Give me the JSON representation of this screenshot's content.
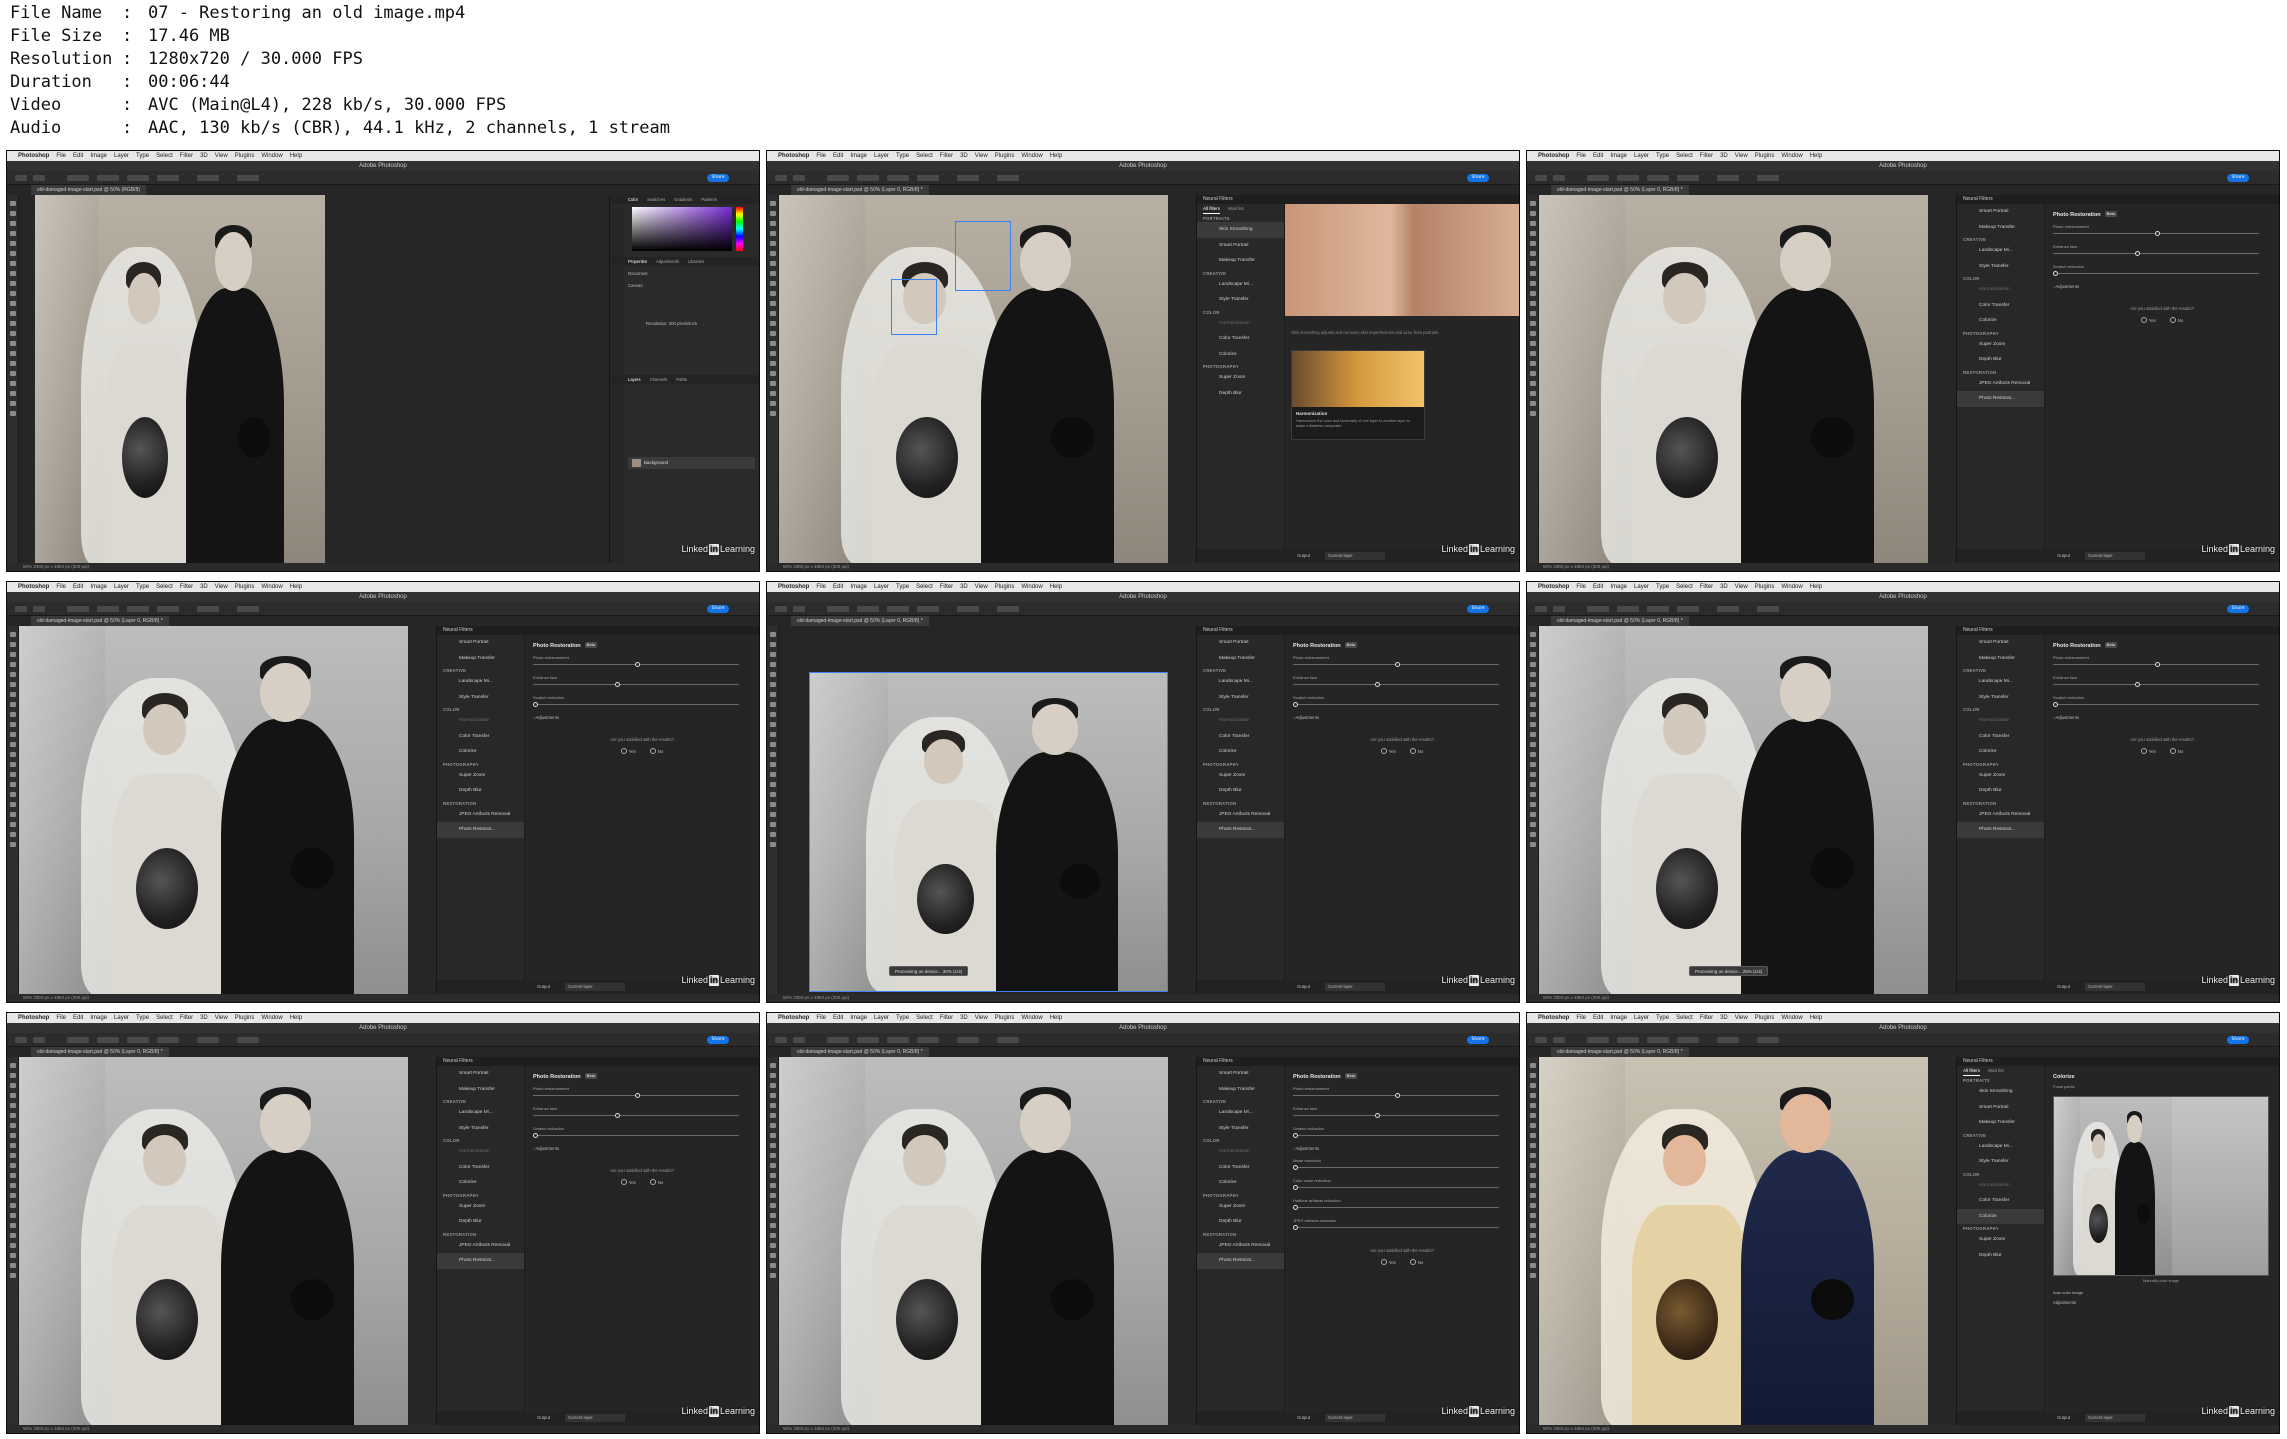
{
  "file_info": [
    {
      "key": "File Name",
      "value": "07 - Restoring an old image.mp4"
    },
    {
      "key": "File Size",
      "value": "17.46 MB"
    },
    {
      "key": "Resolution",
      "value": "1280x720 / 30.000 FPS"
    },
    {
      "key": "Duration",
      "value": "00:06:44"
    },
    {
      "key": "Video",
      "value": "AVC (Main@L4), 228 kb/s, 30.000 FPS"
    },
    {
      "key": "Audio",
      "value": "AAC, 130 kb/s (CBR), 44.1 kHz, 2 channels, 1 stream"
    }
  ],
  "ps": {
    "apple": "",
    "menu_app": "Photoshop",
    "menu_items": [
      "File",
      "Edit",
      "Image",
      "Layer",
      "Type",
      "Select",
      "Filter",
      "3D",
      "View",
      "Plugins",
      "Window",
      "Help"
    ],
    "window_title": "Adobe Photoshop",
    "doc_tab_first": "old-damaged-image-start.psd @ 50% (RGB/8)",
    "doc_tab": "old-damaged-image-start.psd @ 50% (Layer 0, RGB/8) *",
    "status": "50%      3393 px x 4884 px (300 ppi)",
    "share": "Share",
    "brand": {
      "linked": "Linked",
      "in": "in",
      "learning": "Learning"
    }
  },
  "props": {
    "tabs": [
      "Color",
      "Swatches",
      "Gradients",
      "Patterns"
    ],
    "sub_tabs": [
      "Properties",
      "Adjustments",
      "Libraries"
    ],
    "document": "Document",
    "canvas": "Canvas",
    "resolution": "Resolution: 300 pixels/inch",
    "layer_tabs": [
      "Layers",
      "Channels",
      "Paths"
    ],
    "layer_name": "Background"
  },
  "nf": {
    "panel_title": "Neural Filters",
    "tab_all": "All filters",
    "tab_wait": "Wait list",
    "cat_portraits": "PORTRAITS",
    "cat_creative": "CREATIVE",
    "cat_color": "COLOR",
    "cat_photography": "PHOTOGRAPHY",
    "cat_restoration": "RESTORATION",
    "skin_smoothing": "Skin Smoothing",
    "smart_portrait": "Smart Portrait",
    "makeup_transfer": "Makeup Transfer",
    "landscape_mixer": "Landscape Mi...",
    "style_transfer": "Style Transfer",
    "harmonization": "Harmonization",
    "color_transfer": "Color Transfer",
    "colorize": "Colorize",
    "super_zoom": "Super Zoom",
    "depth_blur": "Depth Blur",
    "jpeg_artifacts": "JPEG Artifacts Removal",
    "photo_restoration_short": "Photo Restorat...",
    "beta": "Beta",
    "output_label": "Output",
    "output_value": "Current layer"
  },
  "restoration": {
    "title": "Photo Restoration",
    "beta": "Beta",
    "photo_enhancement": "Photo enhancement",
    "enhance_face": "Enhance face",
    "scratch_reduction": "Scratch reduction",
    "adjustments": "Adjustments",
    "noise_reduction": "Noise reduction",
    "color_noise_reduction": "Color noise reduction",
    "halftone_reduction": "Halftone artifacts reduction",
    "jpeg_reduction": "JPEG artifacts reduction",
    "question": "Are you satisfied with the results?",
    "yes": "Yes",
    "no": "No",
    "values": {
      "photo_enhancement": 50,
      "enhance_face": 40,
      "scratch_reduction": 0
    }
  },
  "skin": {
    "desc": "Skin smoothing adjusts and removes skin imperfections and acne from portraits",
    "card_title": "Harmonization",
    "card_desc": "Harmonizes the color and luminosity of one layer to another layer to make a flawless composite"
  },
  "processing": {
    "text_1": "Processing on device...      30% (1/4)",
    "text_2": "Processing on device...      25% (1/4)"
  },
  "colorize": {
    "title": "Colorize",
    "focal": "Focal points",
    "caption": "Manually color image",
    "auto": "Auto color image",
    "adjustments": "Adjustments"
  },
  "colors": {
    "accent": "#1473e6",
    "panel": "#252525",
    "menu": "#e7e7e7"
  }
}
